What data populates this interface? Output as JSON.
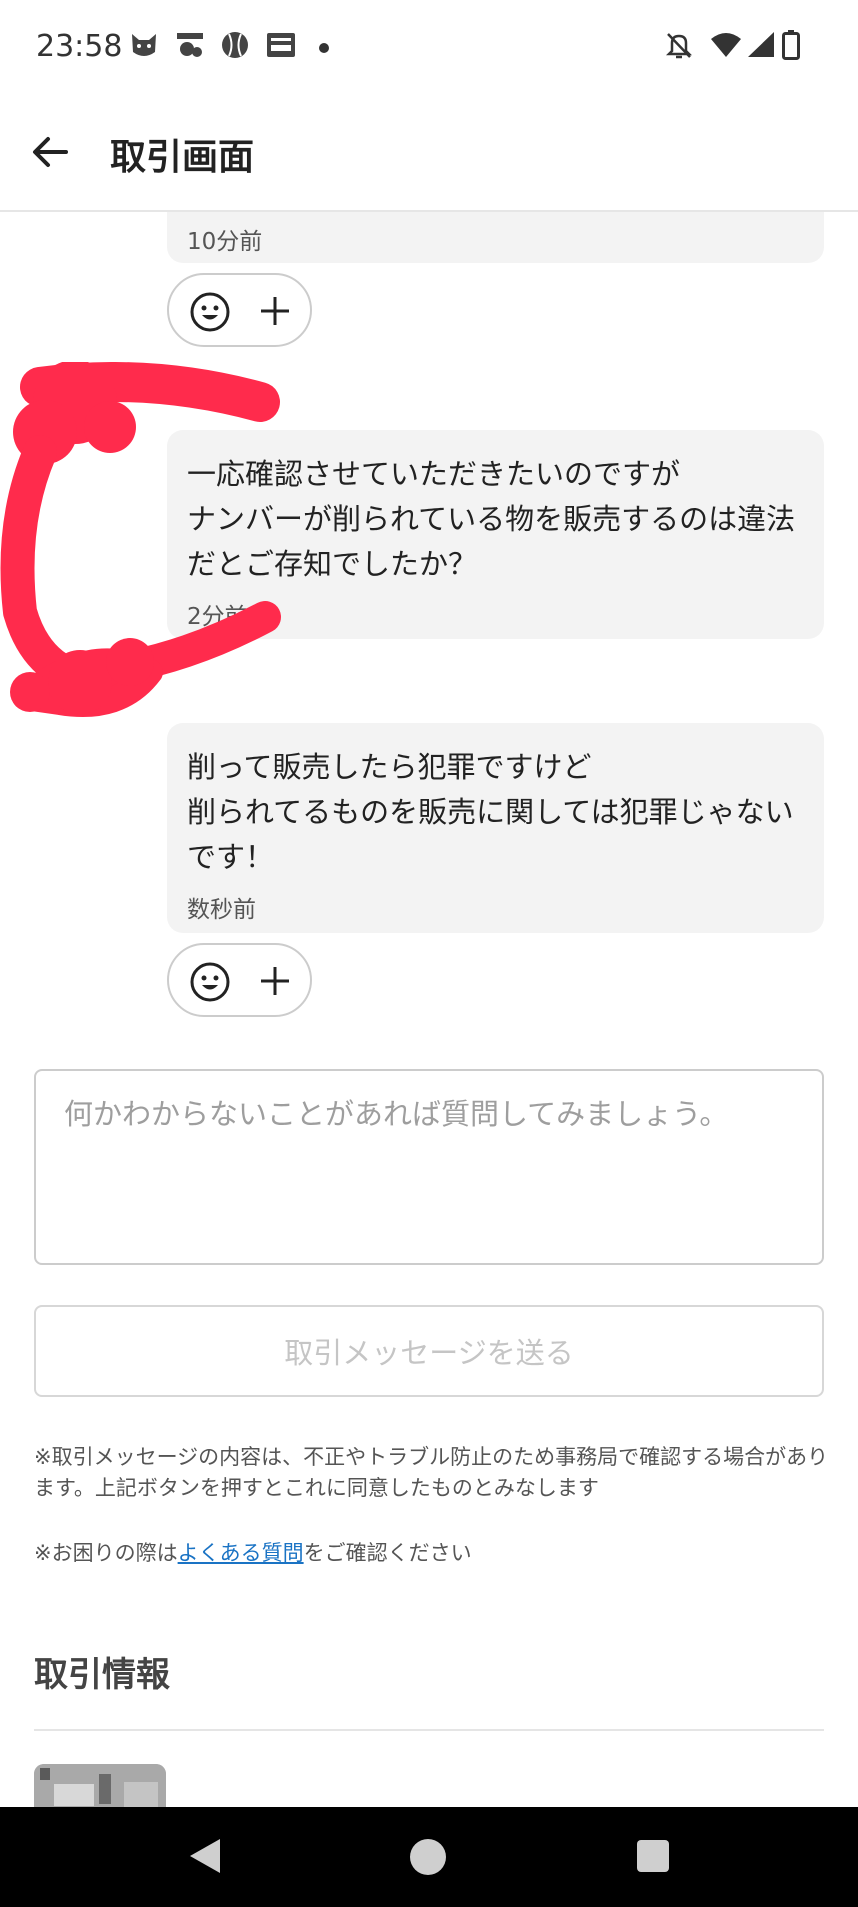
{
  "status_bar": {
    "time": "23:58",
    "left_icons": [
      "cat-notification-icon",
      "jmty-notification-icon",
      "baseball-notification-icon",
      "news-notification-icon",
      "more-dot-icon"
    ],
    "right_icons": [
      "bell-off-icon",
      "wifi-icon",
      "signal-icon",
      "battery-icon"
    ]
  },
  "header": {
    "title": "取引画面",
    "back_icon": "arrow-left-icon"
  },
  "messages": [
    {
      "text": "",
      "time": "10分前"
    },
    {
      "text": "一応確認させていただきたいのですが\nナンバーが削られている物を販売するのは違法だとご存知でしたか？",
      "time": "2分前"
    },
    {
      "text": "削って販売したら犯罪ですけど\n削られてるものを販売に関しては犯罪じゃないです！",
      "time": "数秒前"
    }
  ],
  "reaction": {
    "emoji_icon": "smile-icon",
    "add_icon": "plus-icon",
    "color": "#cccccc"
  },
  "composer": {
    "value": "",
    "placeholder": "何かわからないことがあれば質問してみましょう。"
  },
  "send_button": {
    "label": "取引メッセージを送る"
  },
  "notices": {
    "line1": "※取引メッセージの内容は、不正やトラブル防止のため事務局で確認する場合があります。上記ボタンを押すとこれに同意したものとみなします",
    "line2_prefix": "※お困りの際は",
    "line2_link": "よくある質問",
    "line2_suffix": "をご確認ください"
  },
  "section": {
    "title": "取引情報"
  },
  "colors": {
    "bubble_bg": "#f3f3f3",
    "redaction": "#ff2b4c",
    "link": "#1a73c4",
    "send_disabled_text": "#c5c5c5"
  },
  "nav_bar": {
    "back": "nav-back-icon",
    "home": "nav-home-icon",
    "recents": "nav-recents-icon"
  }
}
